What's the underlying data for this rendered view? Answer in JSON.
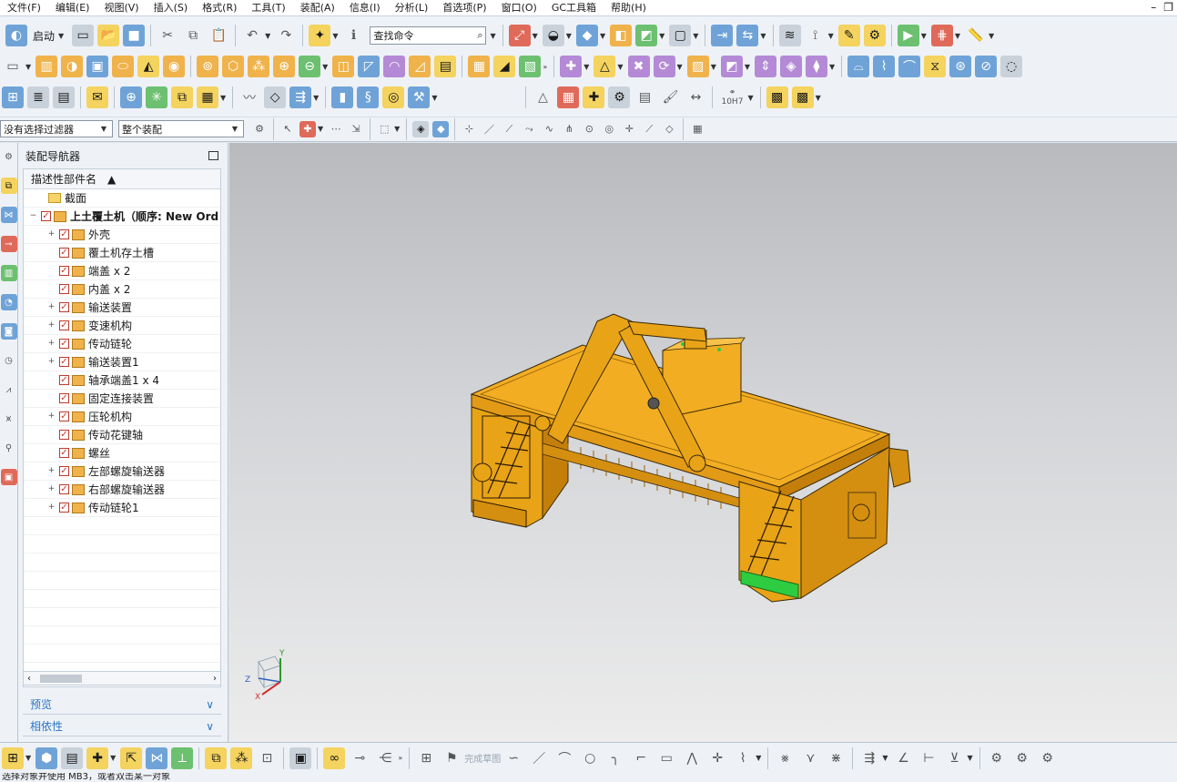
{
  "menu": [
    "文件(F)",
    "编辑(E)",
    "视图(V)",
    "插入(S)",
    "格式(R)",
    "工具(T)",
    "装配(A)",
    "信息(I)",
    "分析(L)",
    "首选项(P)",
    "窗口(O)",
    "GC工具箱",
    "帮助(H)"
  ],
  "toolbar": {
    "start_label": "启动",
    "search_placeholder": "查找命令",
    "filter_select": "没有选择过滤器",
    "assembly_select": "整个装配",
    "tolerance_label": "10H7",
    "sketch_label": "完成草图"
  },
  "navigator": {
    "title": "装配导航器",
    "column_header": "描述性部件名",
    "tree": [
      {
        "label": "截面",
        "expand": "",
        "checked": false,
        "type": "folder",
        "level": 1
      },
      {
        "label": "上土覆土机（顺序: New Ord",
        "expand": "−",
        "checked": true,
        "type": "asm",
        "level": 0,
        "bold": true
      },
      {
        "label": "外壳",
        "expand": "+",
        "checked": true,
        "type": "asm",
        "level": 2
      },
      {
        "label": "覆土机存土槽",
        "expand": "",
        "checked": true,
        "type": "part",
        "level": 2
      },
      {
        "label": "端盖 x 2",
        "expand": "",
        "checked": true,
        "type": "part",
        "level": 2
      },
      {
        "label": "内盖 x 2",
        "expand": "",
        "checked": true,
        "type": "part",
        "level": 2
      },
      {
        "label": "输送装置",
        "expand": "+",
        "checked": true,
        "type": "asm",
        "level": 2
      },
      {
        "label": "变速机构",
        "expand": "+",
        "checked": true,
        "type": "asm",
        "level": 2
      },
      {
        "label": "传动链轮",
        "expand": "+",
        "checked": true,
        "type": "asm",
        "level": 2
      },
      {
        "label": "输送装置1",
        "expand": "+",
        "checked": true,
        "type": "asm",
        "level": 2
      },
      {
        "label": "轴承端盖1 x 4",
        "expand": "",
        "checked": true,
        "type": "part",
        "level": 2
      },
      {
        "label": "固定连接装置",
        "expand": "",
        "checked": true,
        "type": "part",
        "level": 2
      },
      {
        "label": "压轮机构",
        "expand": "+",
        "checked": true,
        "type": "asm",
        "level": 2
      },
      {
        "label": "传动花键轴",
        "expand": "",
        "checked": true,
        "type": "part",
        "level": 2
      },
      {
        "label": "螺丝",
        "expand": "",
        "checked": true,
        "type": "part",
        "level": 2
      },
      {
        "label": "左部螺旋输送器",
        "expand": "+",
        "checked": true,
        "type": "asm",
        "level": 2
      },
      {
        "label": "右部螺旋输送器",
        "expand": "+",
        "checked": true,
        "type": "asm",
        "level": 2
      },
      {
        "label": "传动链轮1",
        "expand": "+",
        "checked": true,
        "type": "asm",
        "level": 2
      }
    ],
    "sections": [
      "预览",
      "相依性"
    ]
  },
  "triad": {
    "x": "X",
    "y": "Y",
    "z": "Z"
  },
  "status": {
    "message": "选择对象并使用 MB3，或者双击某一对象"
  },
  "colors": {
    "model": "#e8a317",
    "model_dark": "#b9770d",
    "highlight": "#2ecc40",
    "accent_text": "#2a74c2"
  }
}
